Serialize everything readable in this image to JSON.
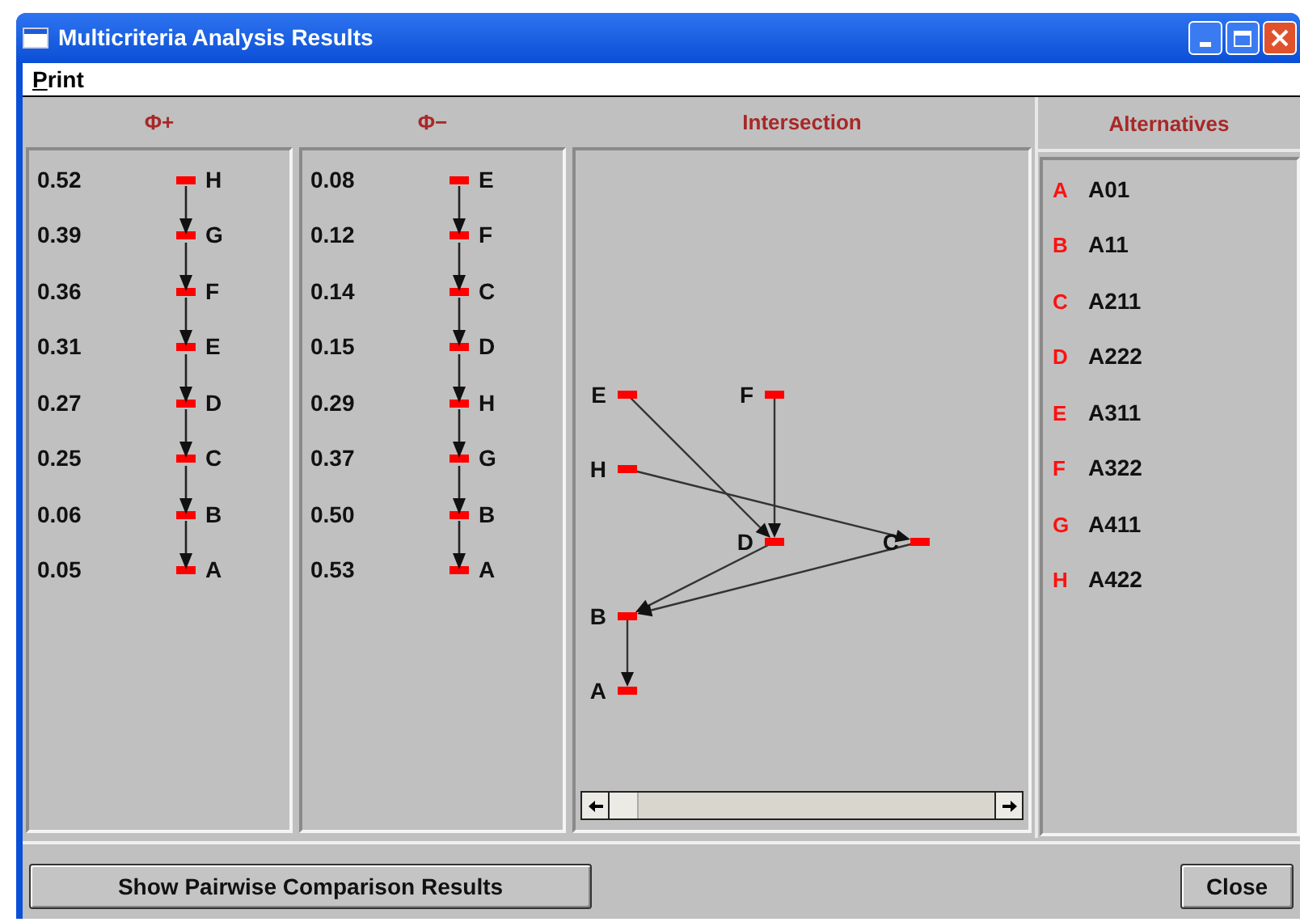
{
  "window": {
    "title": "Multicriteria Analysis Results"
  },
  "menu": [
    {
      "parts": [
        {
          "text": "P",
          "underlined": true
        },
        {
          "text": "rint",
          "underlined": false
        }
      ]
    }
  ],
  "phi_plus": {
    "title": "Φ+",
    "rows": [
      {
        "value": "0.52",
        "label": "H"
      },
      {
        "value": "0.39",
        "label": "G"
      },
      {
        "value": "0.36",
        "label": "F"
      },
      {
        "value": "0.31",
        "label": "E"
      },
      {
        "value": "0.27",
        "label": "D"
      },
      {
        "value": "0.25",
        "label": "C"
      },
      {
        "value": "0.06",
        "label": "B"
      },
      {
        "value": "0.05",
        "label": "A"
      }
    ]
  },
  "phi_minus": {
    "title": "Φ−",
    "rows": [
      {
        "value": "0.08",
        "label": "E"
      },
      {
        "value": "0.12",
        "label": "F"
      },
      {
        "value": "0.14",
        "label": "C"
      },
      {
        "value": "0.15",
        "label": "D"
      },
      {
        "value": "0.29",
        "label": "H"
      },
      {
        "value": "0.37",
        "label": "G"
      },
      {
        "value": "0.50",
        "label": "B"
      },
      {
        "value": "0.53",
        "label": "A"
      }
    ]
  },
  "intersection": {
    "title": "Intersection",
    "nodes": [
      {
        "label": "E"
      },
      {
        "label": "F"
      },
      {
        "label": "H"
      },
      {
        "label": "D"
      },
      {
        "label": "C"
      },
      {
        "label": "B"
      },
      {
        "label": "A"
      }
    ]
  },
  "alternatives": {
    "title": "Alternatives",
    "items": [
      {
        "letter": "A",
        "name": "A01"
      },
      {
        "letter": "B",
        "name": "A11"
      },
      {
        "letter": "C",
        "name": "A211"
      },
      {
        "letter": "D",
        "name": "A222"
      },
      {
        "letter": "E",
        "name": "A311"
      },
      {
        "letter": "F",
        "name": "A322"
      },
      {
        "letter": "G",
        "name": "A411"
      },
      {
        "letter": "H",
        "name": "A422"
      }
    ]
  },
  "buttons": [
    {
      "label": "Show Pairwise Comparison Results",
      "kind": "left"
    },
    {
      "label": "Close",
      "kind": "right"
    }
  ]
}
